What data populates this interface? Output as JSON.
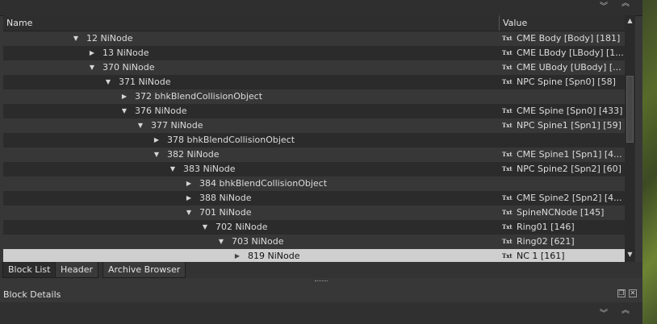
{
  "top_controls": {
    "collapse_icon": "chevron-double-down",
    "expand_icon": "chevron-double-up",
    "collapse_glyph": "︾",
    "expand_glyph": "︽"
  },
  "columns": {
    "name": "Name",
    "value": "Value"
  },
  "value_type_badge": "Txt",
  "rows": [
    {
      "name": "12 NiNode",
      "depth": 0,
      "expander": "expanded",
      "value": "CME Body [Body] [181]"
    },
    {
      "name": "13 NiNode",
      "depth": 1,
      "expander": "collapsed",
      "value": "CME LBody [LBody] [1..."
    },
    {
      "name": "370 NiNode",
      "depth": 1,
      "expander": "expanded",
      "value": "CME UBody [UBody] [..."
    },
    {
      "name": "371 NiNode",
      "depth": 2,
      "expander": "expanded",
      "value": "NPC Spine [Spn0] [58]"
    },
    {
      "name": "372 bhkBlendCollisionObject",
      "depth": 3,
      "expander": "collapsed",
      "value": ""
    },
    {
      "name": "376 NiNode",
      "depth": 3,
      "expander": "expanded",
      "value": "CME Spine [Spn0] [433]"
    },
    {
      "name": "377 NiNode",
      "depth": 4,
      "expander": "expanded",
      "value": "NPC Spine1 [Spn1] [59]"
    },
    {
      "name": "378 bhkBlendCollisionObject",
      "depth": 5,
      "expander": "collapsed",
      "value": ""
    },
    {
      "name": "382 NiNode",
      "depth": 5,
      "expander": "expanded",
      "value": "CME Spine1 [Spn1] [4..."
    },
    {
      "name": "383 NiNode",
      "depth": 6,
      "expander": "expanded",
      "value": "NPC Spine2 [Spn2] [60]"
    },
    {
      "name": "384 bhkBlendCollisionObject",
      "depth": 7,
      "expander": "collapsed",
      "value": ""
    },
    {
      "name": "388 NiNode",
      "depth": 7,
      "expander": "collapsed",
      "value": "CME Spine2 [Spn2] [4..."
    },
    {
      "name": "701 NiNode",
      "depth": 7,
      "expander": "expanded",
      "value": "SpineNCNode [145]"
    },
    {
      "name": "702 NiNode",
      "depth": 8,
      "expander": "expanded",
      "value": "Ring01 [146]"
    },
    {
      "name": "703 NiNode",
      "depth": 9,
      "expander": "expanded",
      "value": "Ring02 [621]"
    },
    {
      "name": "819 NiNode",
      "depth": 10,
      "expander": "collapsed",
      "value": "NC 1 [161]",
      "selected": true
    }
  ],
  "tabs": [
    {
      "label": "Block List",
      "active": true
    },
    {
      "label": "Header",
      "active": false
    },
    {
      "label": "Archive Browser",
      "active": false
    }
  ],
  "block_details": {
    "title": "Block Details",
    "float_icon": "float-window",
    "close_icon": "close",
    "close_glyph": "✕"
  },
  "scrollbar": {
    "position_fraction": 0.33
  }
}
